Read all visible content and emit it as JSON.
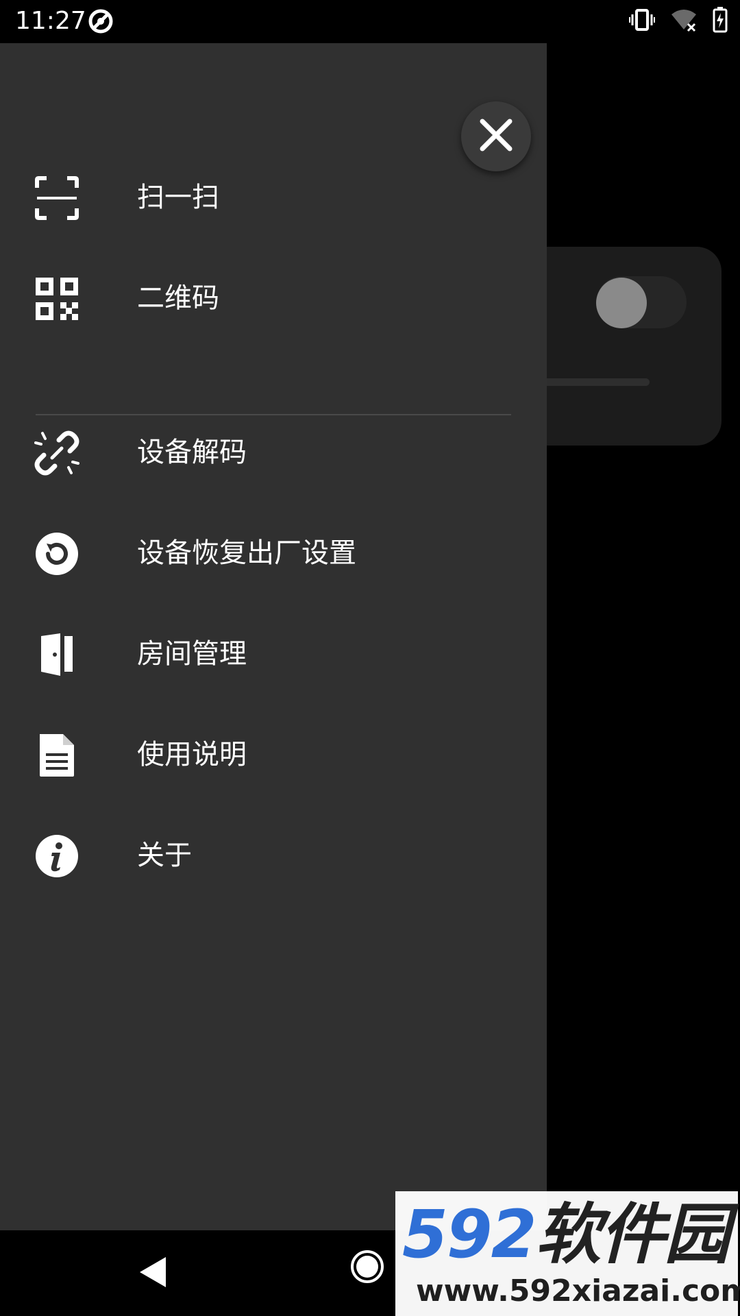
{
  "status_bar": {
    "time": "11:27"
  },
  "drawer": {
    "close_icon": "close-icon",
    "items": [
      {
        "label": "扫一扫",
        "icon": "scan-icon"
      },
      {
        "label": "二维码",
        "icon": "qr-code-icon"
      },
      {
        "label": "设备解码",
        "icon": "link-off-icon"
      },
      {
        "label": "设备恢复出厂设置",
        "icon": "restore-icon"
      },
      {
        "label": "房间管理",
        "icon": "door-icon"
      },
      {
        "label": "使用说明",
        "icon": "document-icon"
      },
      {
        "label": "关于",
        "icon": "info-icon"
      }
    ]
  },
  "background": {
    "toggle_on": false
  },
  "watermark": {
    "brand_number": "592",
    "brand_text": "软件园",
    "url": "www.592xiazai.com"
  },
  "colors": {
    "drawer_bg": "#303030",
    "text": "#ffffff",
    "brand_blue": "#2f6fd6"
  }
}
